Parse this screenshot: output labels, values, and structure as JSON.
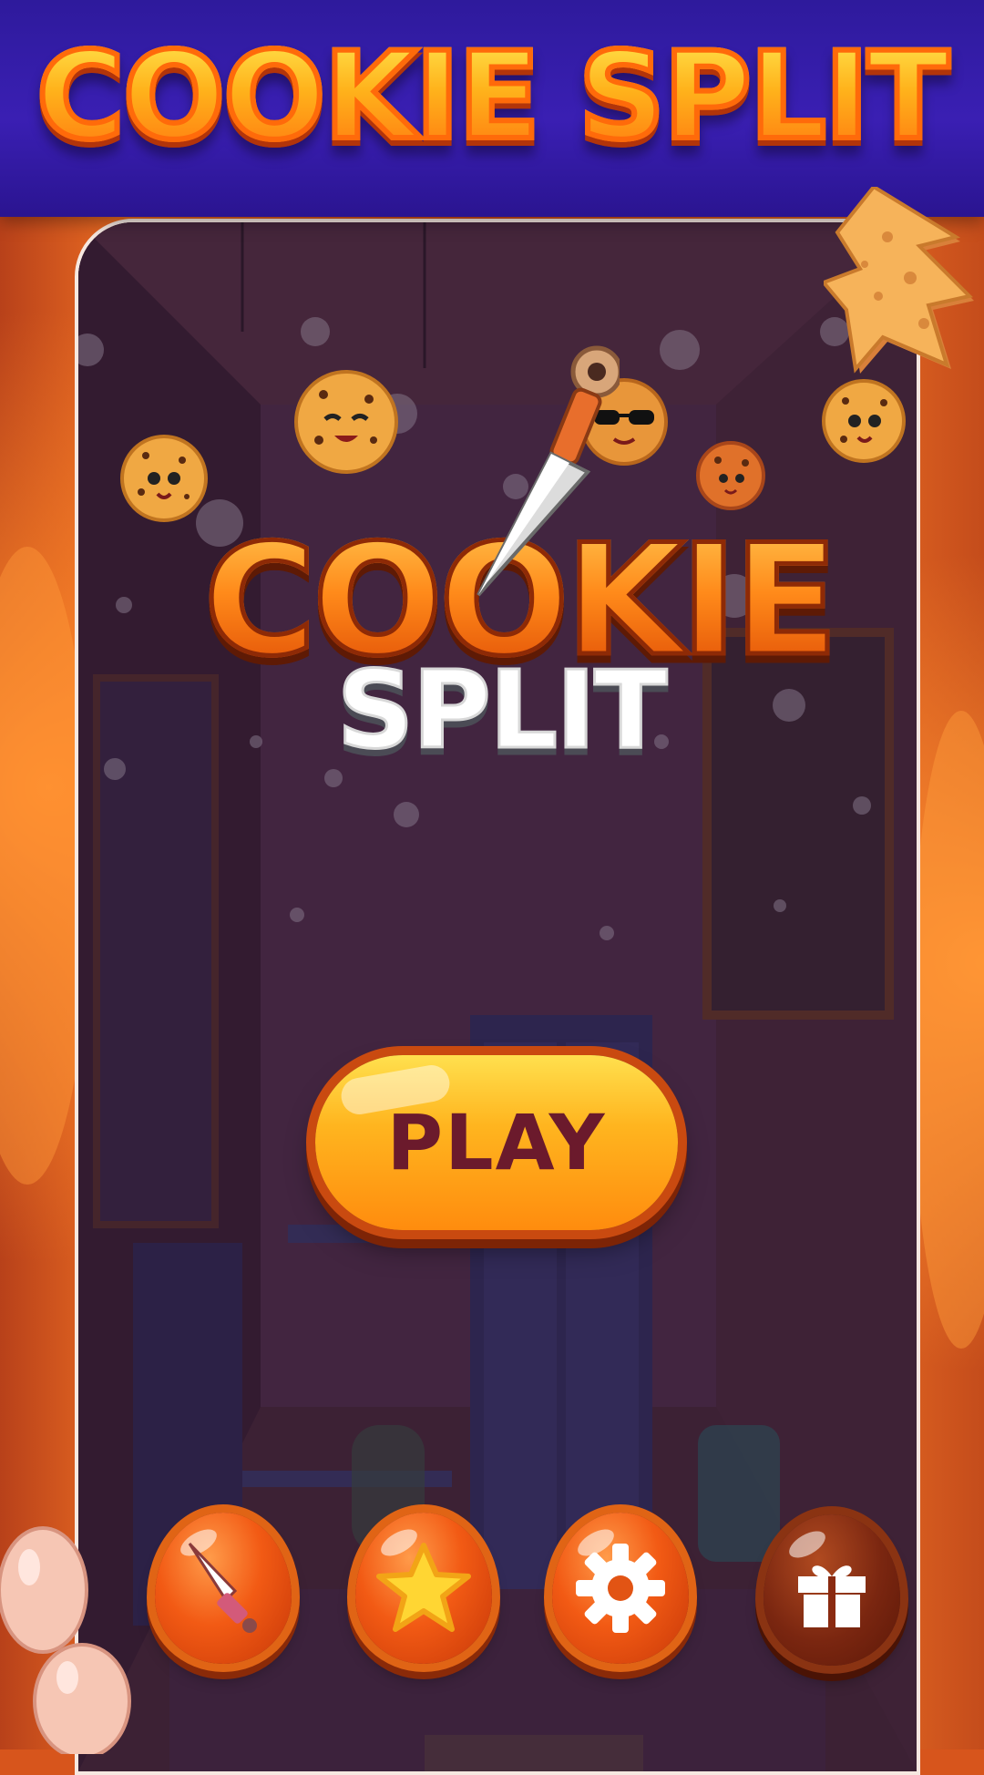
{
  "banner": {
    "title": "COOKIE SPLIT"
  },
  "logo": {
    "word": "COOKIE",
    "sub": "SPLIT"
  },
  "play_button": {
    "label": "PLAY"
  },
  "bottom_menu": [
    {
      "name": "knife-shop-button",
      "icon": "knife-icon"
    },
    {
      "name": "rate-button",
      "icon": "star-icon"
    },
    {
      "name": "settings-button",
      "icon": "gear-icon"
    },
    {
      "name": "gift-button",
      "icon": "gift-icon"
    }
  ],
  "colors": {
    "banner": "#3a1fb3",
    "title_orange": "#ffb21b",
    "play_text": "#6b1a2c",
    "button_orange": "#f25a14"
  }
}
